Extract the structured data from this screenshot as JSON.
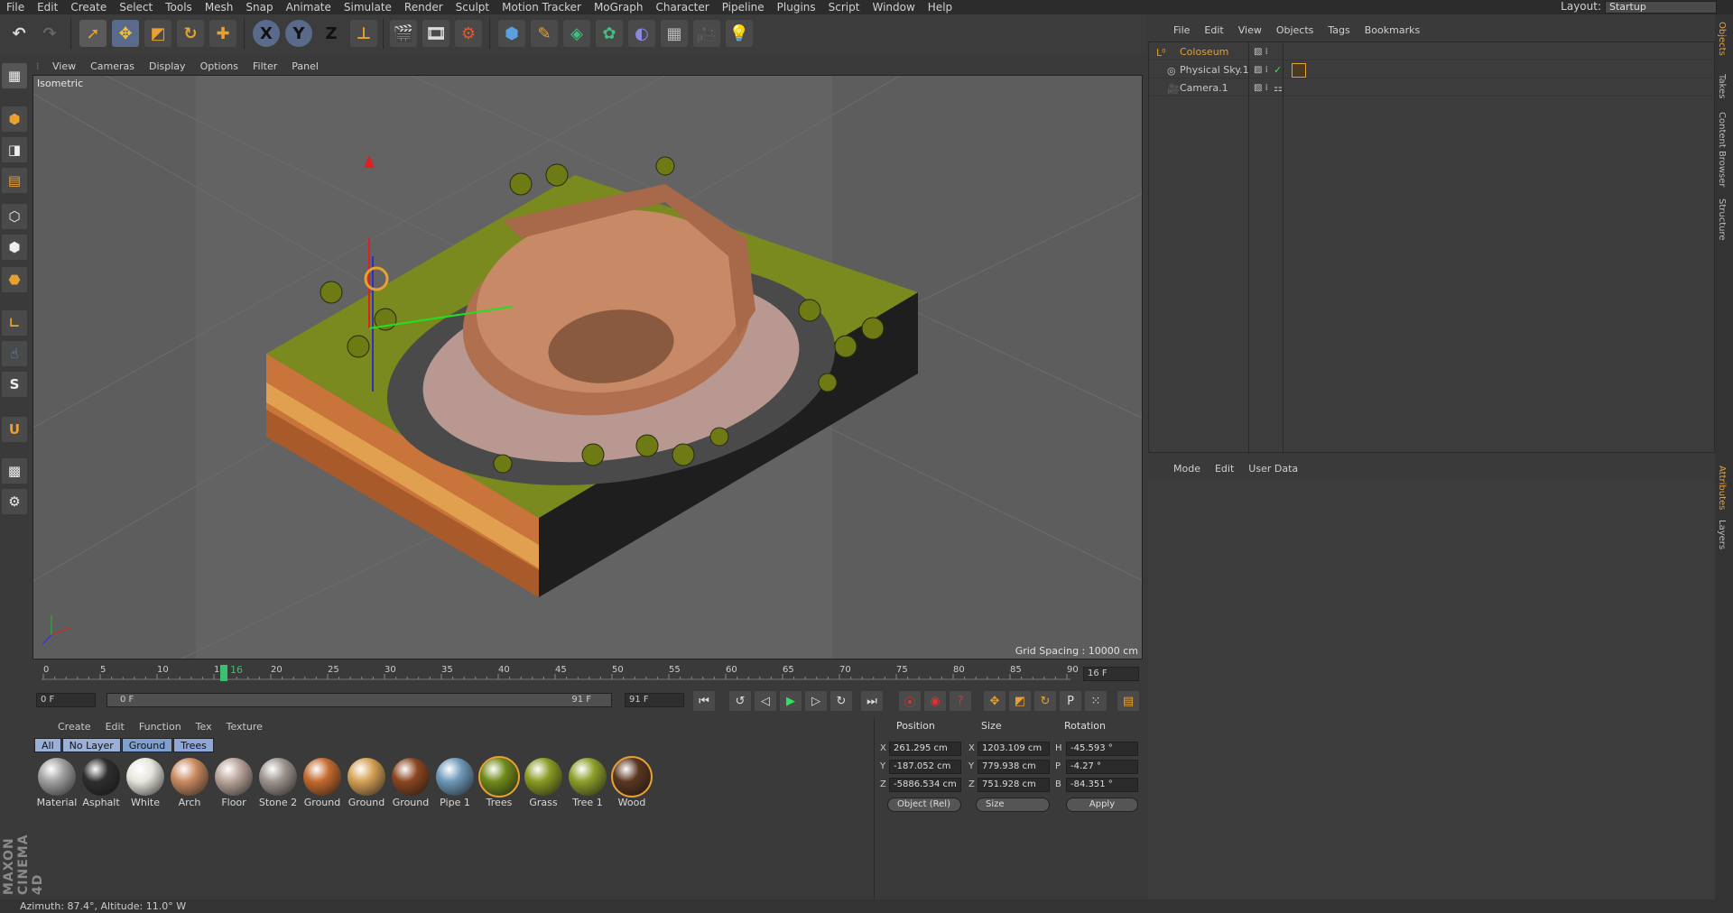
{
  "menubar": {
    "items": [
      "File",
      "Edit",
      "Create",
      "Select",
      "Tools",
      "Mesh",
      "Snap",
      "Animate",
      "Simulate",
      "Render",
      "Sculpt",
      "Motion Tracker",
      "MoGraph",
      "Character",
      "Pipeline",
      "Plugins",
      "Script",
      "Window",
      "Help"
    ],
    "layout_label": "Layout:",
    "layout_value": "Startup"
  },
  "toolbar": {
    "icons": [
      "undo-icon",
      "redo-icon",
      "live-select-icon",
      "move-icon",
      "scale-icon",
      "rotate-icon",
      "add-icon",
      "x-axis-icon",
      "y-axis-icon",
      "z-axis-icon",
      "coordinate-system-icon",
      "render-view-icon",
      "render-picture-viewer-icon",
      "edit-render-settings-icon",
      "cube-icon",
      "pen-icon",
      "subdivision-icon",
      "array-icon",
      "deformer-icon",
      "floor-icon",
      "camera-icon",
      "light-icon"
    ],
    "x_label": "X",
    "y_label": "Y",
    "z_label": "Z"
  },
  "left_toolbar": {
    "icons": [
      "make-editable-icon",
      "model-mode-icon",
      "texture-mode-icon",
      "workplane-icon",
      "points-mode-icon",
      "edges-mode-icon",
      "polygons-mode-icon",
      "axis-mode-icon",
      "tweak-mode-icon",
      "solo-icon",
      "snap-icon",
      "lock-workplane-icon",
      "planar-workplane-icon"
    ]
  },
  "viewport": {
    "menu": [
      "View",
      "Cameras",
      "Display",
      "Options",
      "Filter",
      "Panel"
    ],
    "label": "Isometric",
    "grid_spacing": "Grid Spacing : 10000 cm"
  },
  "timeline": {
    "ticks": [
      "0",
      "5",
      "10",
      "15",
      "20",
      "25",
      "30",
      "35",
      "40",
      "45",
      "50",
      "55",
      "60",
      "65",
      "70",
      "75",
      "80",
      "85",
      "90"
    ],
    "current_frame": "16",
    "end_field": "16 F"
  },
  "frames_bar": {
    "start": "0 F",
    "range_start": "0 F",
    "range_end": "91 F",
    "end": "91 F"
  },
  "materials": {
    "menu": [
      "Create",
      "Edit",
      "Function",
      "Tex",
      "Texture"
    ],
    "filters": [
      {
        "label": "All",
        "color": "#9ab0d8"
      },
      {
        "label": "No Layer",
        "color": "#9ab0d8"
      },
      {
        "label": "Ground",
        "color": "#7ea0d0"
      },
      {
        "label": "Trees",
        "color": "#8fa6d8"
      }
    ],
    "items": [
      {
        "label": "Material",
        "color": "#a0a0a0"
      },
      {
        "label": "Asphalt",
        "color": "#2e2e2e"
      },
      {
        "label": "White",
        "color": "#e8e6dc"
      },
      {
        "label": "Arch",
        "color": "#c98a60"
      },
      {
        "label": "Floor",
        "color": "#b9a49a"
      },
      {
        "label": "Stone 2",
        "color": "#9e948f"
      },
      {
        "label": "Ground",
        "color": "#c46a2e"
      },
      {
        "label": "Ground",
        "color": "#d5a055"
      },
      {
        "label": "Ground",
        "color": "#8a4620"
      },
      {
        "label": "Pipe 1",
        "color": "#6e98b8"
      },
      {
        "label": "Trees",
        "color": "#6f8a1a"
      },
      {
        "label": "Grass",
        "color": "#8a9a22"
      },
      {
        "label": "Tree 1",
        "color": "#8d9e2a"
      },
      {
        "label": "Wood",
        "color": "#5a3620"
      }
    ]
  },
  "coordinates": {
    "headers": {
      "position": "Position",
      "size": "Size",
      "rotation": "Rotation"
    },
    "position": {
      "x": "261.295 cm",
      "y": "-187.052 cm",
      "z": "-5886.534 cm"
    },
    "size": {
      "x": "1203.109 cm",
      "y": "779.938 cm",
      "z": "751.928 cm"
    },
    "rotation": {
      "h": "-45.593 °",
      "p": "-4.27 °",
      "b": "-84.351 °"
    },
    "axis_labels": {
      "x": "X",
      "y": "Y",
      "z": "Z",
      "h": "H",
      "p": "P",
      "b": "B"
    },
    "mode_dropdown": "Object (Rel)",
    "size_dropdown": "Size",
    "apply": "Apply"
  },
  "objects": {
    "menu": [
      "File",
      "Edit",
      "View",
      "Objects",
      "Tags",
      "Bookmarks"
    ],
    "rows": [
      {
        "name": "Coloseum",
        "color": "#e0a030"
      },
      {
        "name": "Physical Sky.1",
        "color": "#d0d0d0"
      },
      {
        "name": "Camera.1",
        "color": "#d0d0d0"
      }
    ]
  },
  "attributes": {
    "menu": [
      "Mode",
      "Edit",
      "User Data"
    ]
  },
  "right_tabs": [
    "Objects",
    "Takes",
    "Content Browser",
    "Structure",
    "Attributes",
    "Layers"
  ],
  "status": "Azimuth: 87.4°, Altitude: 11.0°  W",
  "logo": "MAXON CINEMA 4D"
}
